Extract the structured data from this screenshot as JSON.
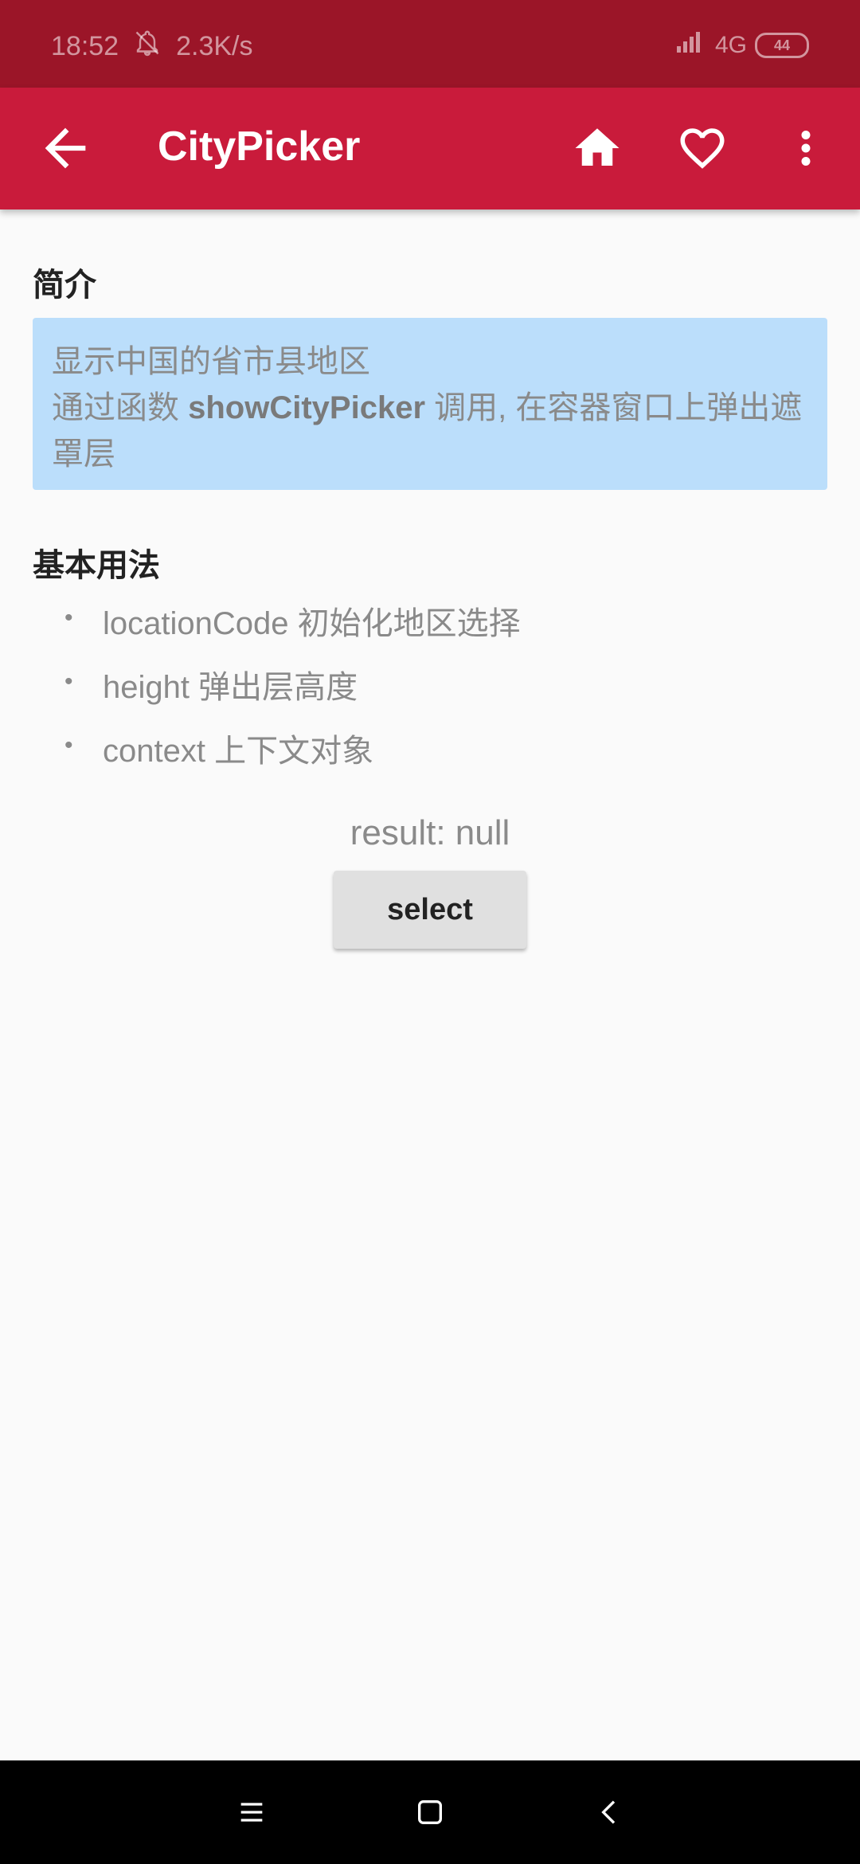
{
  "status_bar": {
    "time": "18:52",
    "net_speed": "2.3K/s",
    "network": "4G",
    "battery": "44"
  },
  "app_bar": {
    "title": "CityPicker"
  },
  "intro": {
    "title": "简介",
    "line1": "显示中国的省市县地区",
    "line2_prefix": "通过函数 ",
    "line2_func": "showCityPicker",
    "line2_suffix": " 调用, 在容器窗口上弹出遮罩层"
  },
  "usage": {
    "title": "基本用法",
    "items": [
      "locationCode 初始化地区选择",
      "height 弹出层高度",
      "context 上下文对象"
    ]
  },
  "result_text": "result: null",
  "select_label": "select",
  "colors": {
    "status_bar": "#9b1528",
    "app_bar": "#c91b3b",
    "info_box": "#bbdefb",
    "background": "#fafafa"
  },
  "icons": [
    "signal-off-icon",
    "back-arrow-icon",
    "home-icon",
    "heart-outline-icon",
    "more-vert-icon",
    "menu-icon",
    "square-icon",
    "chevron-left-icon"
  ]
}
